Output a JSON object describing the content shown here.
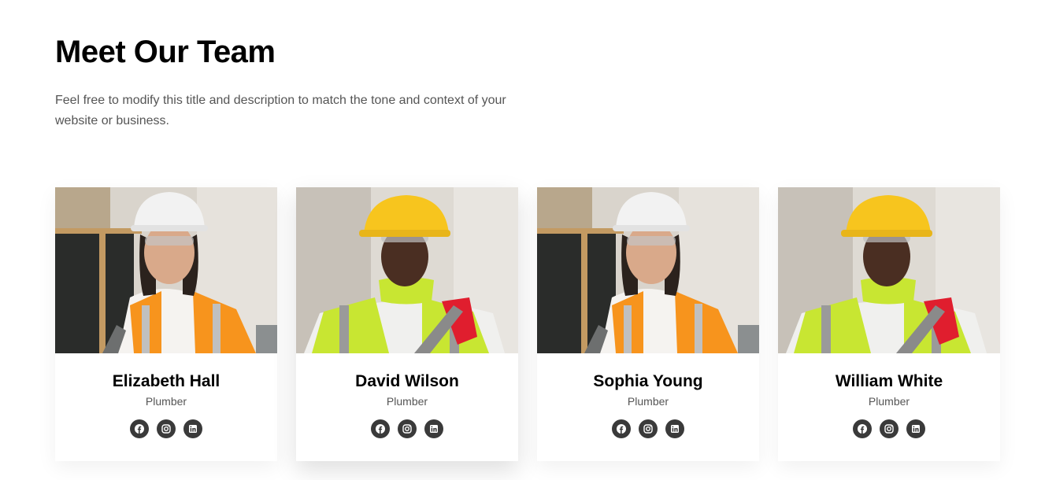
{
  "section": {
    "title": "Meet Our Team",
    "description": "Feel free to modify this title and description to match the tone and context of your website or business."
  },
  "members": [
    {
      "name": "Elizabeth Hall",
      "role": "Plumber",
      "photo": "woman-white-hardhat-orange-vest"
    },
    {
      "name": "David Wilson",
      "role": "Plumber",
      "photo": "woman-yellow-hardhat-green-vest"
    },
    {
      "name": "Sophia Young",
      "role": "Plumber",
      "photo": "woman-white-hardhat-orange-vest"
    },
    {
      "name": "William White",
      "role": "Plumber",
      "photo": "woman-yellow-hardhat-green-vest"
    }
  ],
  "social_icons": [
    "facebook-icon",
    "instagram-icon",
    "linkedin-icon"
  ],
  "colors": {
    "title": "#000000",
    "text": "#555555",
    "social_bg": "#3a3a3a",
    "orange_vest": "#f7941d",
    "green_vest": "#c8e632",
    "white_hat": "#f2f2f2",
    "yellow_hat": "#f7c51e"
  }
}
